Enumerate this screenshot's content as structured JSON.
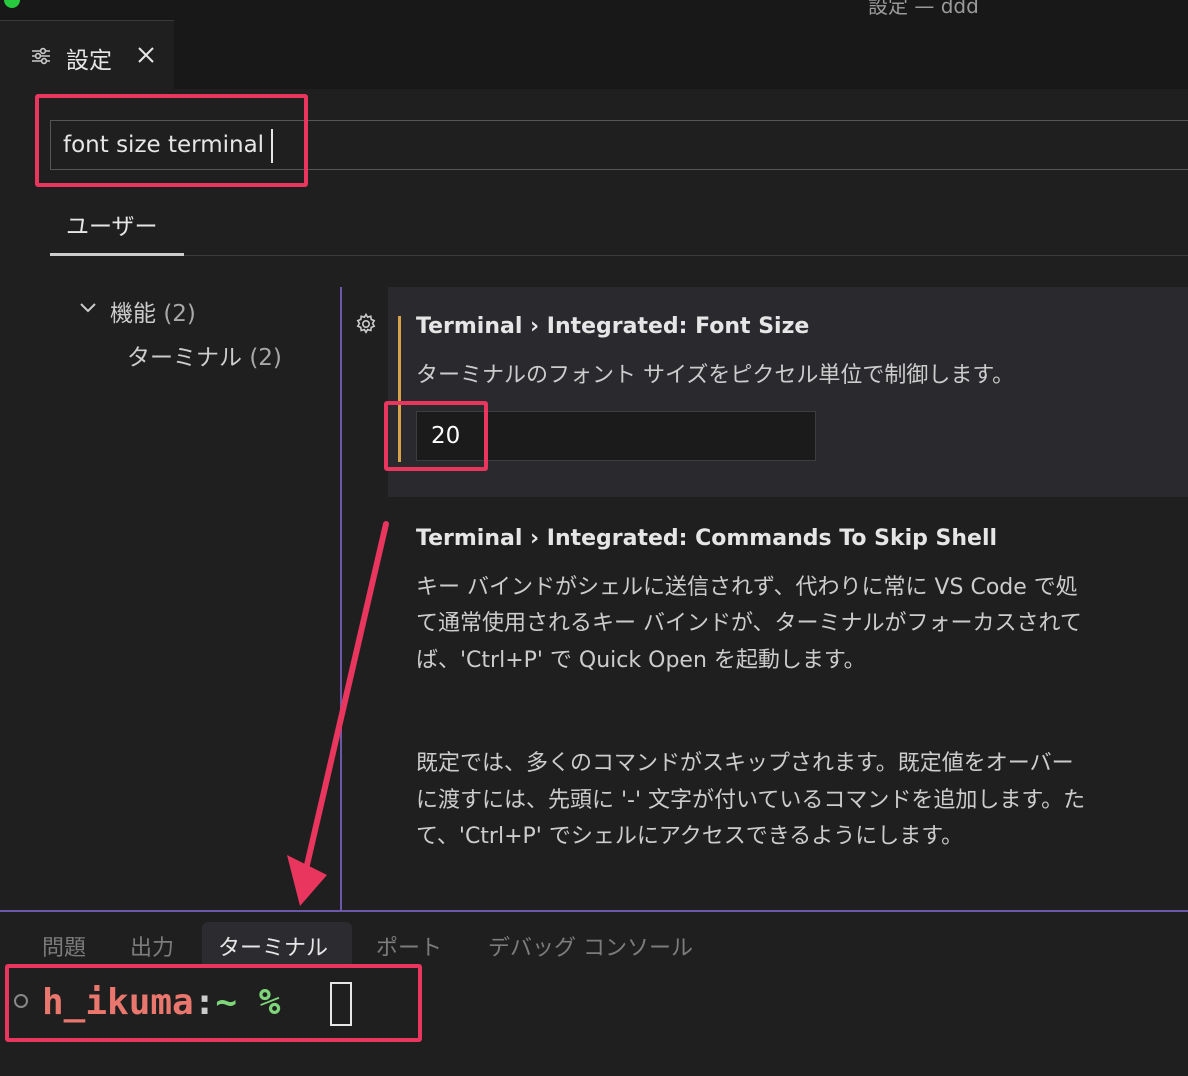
{
  "window": {
    "title": "設定 — ddd"
  },
  "tab": {
    "label": "設定",
    "icon": "settings-sliders-icon",
    "close_icon": "close-icon"
  },
  "search": {
    "value": "font size terminal"
  },
  "scope": {
    "user_tab": "ユーザー"
  },
  "toc": {
    "group": {
      "label": "機能",
      "count": "(2)"
    },
    "item": {
      "label": "ターミナル",
      "count": "(2)"
    }
  },
  "settings": [
    {
      "category": "Terminal › Integrated: ",
      "name": "Font Size",
      "description": "ターミナルのフォント サイズをピクセル単位で制御します。",
      "value": "20",
      "modified": true
    },
    {
      "category": "Terminal › Integrated: ",
      "name": "Commands To Skip Shell",
      "description_lines": [
        "キー バインドがシェルに送信されず、代わりに常に VS Code で処",
        "て通常使用されるキー バインドが、ターミナルがフォーカスされて",
        "ば、'Ctrl+P' で Quick Open を起動します。"
      ],
      "description_lines_2": [
        "既定では、多くのコマンドがスキップされます。既定値をオーバー",
        "に渡すには、先頭に '-' 文字が付いているコマンドを追加します。た",
        "て、'Ctrl+P' でシェルにアクセスできるようにします。"
      ]
    }
  ],
  "panel": {
    "tabs": [
      "問題",
      "出力",
      "ターミナル",
      "ポート",
      "デバッグ コンソール"
    ],
    "active_tab": "ターミナル"
  },
  "terminal": {
    "user": "h_ikuma",
    "colon": ":",
    "path": "~",
    "prompt": " %"
  },
  "colors": {
    "highlight": "#e8365e",
    "modified_indicator": "#d7a24b",
    "sash": "#6c58a8",
    "term_user": "#e9776d",
    "term_prompt": "#7ed67a"
  }
}
